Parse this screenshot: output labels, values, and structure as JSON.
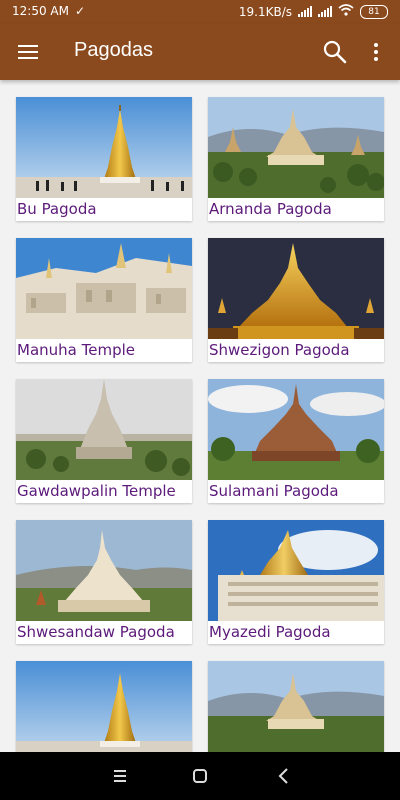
{
  "status_bar": {
    "time": "12:50 AM",
    "check": "✓",
    "net_speed": "19.1KB/s",
    "battery": "81"
  },
  "app_bar": {
    "title": "Pagodas",
    "menu_icon": "hamburger-menu-icon",
    "search_icon": "search-icon",
    "more_icon": "more-vert-icon"
  },
  "colors": {
    "primary": "#8b4a1d",
    "label_text": "#5c1a7a",
    "background": "#f2f2f2"
  },
  "pagodas": [
    {
      "name": "Bu Pagoda"
    },
    {
      "name": "Arnanda Pagoda"
    },
    {
      "name": "Manuha Temple"
    },
    {
      "name": "Shwezigon Pagoda"
    },
    {
      "name": "Gawdawpalin Temple"
    },
    {
      "name": "Sulamani Pagoda"
    },
    {
      "name": "Shwesandaw Pagoda"
    },
    {
      "name": "Myazedi Pagoda"
    },
    {
      "name": ""
    },
    {
      "name": ""
    }
  ],
  "nav_bar": {
    "recents_icon": "recents-icon",
    "home_icon": "home-icon",
    "back_icon": "back-icon"
  }
}
